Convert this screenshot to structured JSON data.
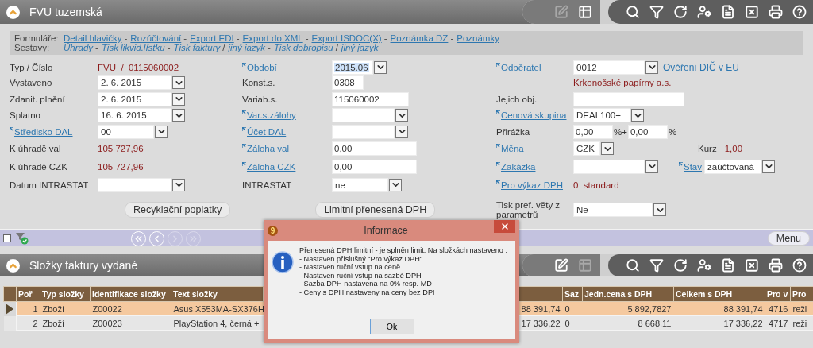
{
  "window": {
    "title": "FVU tuzemská",
    "toolbar": [
      {
        "kind": "edit",
        "disabled": true
      },
      {
        "kind": "table",
        "disabled": false
      },
      {
        "kind": "search",
        "disabled": false
      },
      {
        "kind": "filter",
        "disabled": false
      },
      {
        "kind": "refresh",
        "disabled": false
      },
      {
        "kind": "user-settings",
        "disabled": false
      },
      {
        "kind": "document",
        "disabled": false
      },
      {
        "kind": "excel",
        "disabled": false
      },
      {
        "kind": "print",
        "disabled": false
      },
      {
        "kind": "help",
        "disabled": false
      }
    ]
  },
  "links": [
    {
      "title": "Formuláře:",
      "items": [
        {
          "label": "Detail hlavičky",
          "separator": "-"
        },
        {
          "label": "Rozúčtování",
          "separator": "-"
        },
        {
          "label": "Export EDI",
          "separator": "-"
        },
        {
          "label": "Export do XML",
          "separator": "-"
        },
        {
          "label": "Export ISDOC(X)",
          "separator": "-"
        },
        {
          "label": "Poznámka DZ",
          "separator": "-"
        },
        {
          "label": "Poznámky"
        }
      ]
    },
    {
      "title": "Sestavy:",
      "items": [
        {
          "label": "Úhrady",
          "separator": "-"
        },
        {
          "label": "Tisk likvid.lístku",
          "separator": "-"
        },
        {
          "label": "Tisk faktury",
          "separator": "/"
        },
        {
          "label": "jiný jazyk",
          "separator": "-"
        },
        {
          "label": "Tisk dobropisu",
          "separator": "/"
        },
        {
          "label": "jiný jazyk"
        }
      ]
    }
  ],
  "form": {
    "columns": [
      [
        {
          "label": "Typ / Číslo",
          "linked": false,
          "kind": "value",
          "value": "FVU  /  0115060002"
        },
        {
          "label": "Vystaveno",
          "linked": false,
          "kind": "select",
          "value": "2. 6. 2015"
        },
        {
          "label": "Zdanit. plnění",
          "linked": false,
          "kind": "select",
          "value": "2. 6. 2015"
        },
        {
          "label": "Splatno",
          "linked": false,
          "kind": "select",
          "value": "16. 6. 2015"
        },
        {
          "label": "Středisko DAL",
          "linked": true,
          "kind": "select",
          "value": "00"
        },
        {
          "label": "K úhradě val",
          "linked": false,
          "kind": "value",
          "value": "105 727,96"
        },
        {
          "label": "K úhradě CZK",
          "linked": false,
          "kind": "value",
          "value": "105 727,96"
        },
        {
          "label": "Datum INTRASTAT",
          "linked": false,
          "kind": "select"
        }
      ],
      [
        {
          "label": "Období",
          "linked": true,
          "kind": "select",
          "value": "2015.06",
          "highlighted": true
        },
        {
          "label": "Konst.s.",
          "linked": false,
          "kind": "input",
          "value": "0308"
        },
        {
          "label": "Variab.s.",
          "linked": false,
          "kind": "input",
          "value": "115060002"
        },
        {
          "label": "Var.s.zálohy",
          "linked": true,
          "kind": "select"
        },
        {
          "label": "Účet DAL",
          "linked": true,
          "kind": "select"
        },
        {
          "label": "Záloha val",
          "linked": true,
          "kind": "input",
          "value": "0,00"
        },
        {
          "label": "Záloha CZK",
          "linked": true,
          "kind": "input",
          "value": "0,00"
        },
        {
          "label": "INTRASTAT",
          "linked": false,
          "kind": "select",
          "value": "ne"
        }
      ],
      [
        {
          "label": "Odběratel",
          "linked": true,
          "kind": "select",
          "value": "0012",
          "link": "Ověření DIČ v EU"
        },
        {
          "kind": "value",
          "value": "Krkonošské papírny a.s."
        },
        {
          "label": "Jejich obj.",
          "linked": false,
          "kind": "input"
        },
        {
          "label": "Cenová skupina",
          "linked": true,
          "kind": "select",
          "value": "DEAL100+"
        },
        {
          "label": "Přirážka",
          "linked": false,
          "kind": "percent",
          "values": [
            "0,00",
            "0,00"
          ],
          "signs": [
            "%+",
            "%"
          ]
        },
        {
          "label": "Měna",
          "linked": true,
          "kind": "select",
          "value": "CZK",
          "extra": {
            "label": "Kurz",
            "linked": false,
            "kind": "value",
            "value": "1,00"
          }
        },
        {
          "label": "Zakázka",
          "linked": true,
          "kind": "select",
          "extra": {
            "label": "Stav",
            "linked": true,
            "kind": "select",
            "value": "zaúčtovaná"
          }
        },
        {
          "label": "Pro výkaz DPH",
          "linked": true,
          "kind": "value",
          "value": "0  standard"
        },
        {
          "label": "Tisk pref. věty z parametrů",
          "linked": false,
          "kind": "select",
          "value": "Ne"
        }
      ]
    ],
    "buttons": [
      "Recyklační poplatky",
      "Limitní přenesená DPH"
    ]
  },
  "navigator": {
    "checked": false,
    "buttons": [
      {
        "kind": "first",
        "disabled": false
      },
      {
        "kind": "prev",
        "disabled": false
      },
      {
        "kind": "next",
        "disabled": true
      },
      {
        "kind": "last",
        "disabled": true
      }
    ],
    "menu": "Menu"
  },
  "subgrid": {
    "title": "Složky faktury vydané",
    "toolbar": [
      {
        "kind": "edit",
        "disabled": false
      },
      {
        "kind": "table",
        "disabled": true
      },
      {
        "kind": "search",
        "disabled": false
      },
      {
        "kind": "filter",
        "disabled": false
      },
      {
        "kind": "refresh",
        "disabled": false
      },
      {
        "kind": "user-settings",
        "disabled": false
      },
      {
        "kind": "document",
        "disabled": false
      },
      {
        "kind": "excel",
        "disabled": false
      },
      {
        "kind": "print",
        "disabled": false
      },
      {
        "kind": "help",
        "disabled": false
      }
    ]
  },
  "table": {
    "columns": [
      {
        "label": "Poř"
      },
      {
        "label": "Typ složky"
      },
      {
        "label": "Identifikace složky"
      },
      {
        "label": "Text složky"
      },
      {},
      {
        "label": "Saz"
      },
      {
        "label": "Jedn.cena s DPH"
      },
      {
        "label": "Celkem s DPH"
      },
      {
        "label": "Pro v"
      },
      {
        "label": "Pro"
      }
    ],
    "rows": [
      {
        "selected": true,
        "cells": [
          "1",
          "Zboží",
          "Z00022",
          "Asus X553MA-SX376H",
          "88 391,74",
          "0",
          "5 892,7827",
          "88 391,74",
          "4716",
          "reži"
        ]
      },
      {
        "selected": false,
        "cells": [
          "2",
          "Zboží",
          "Z00023",
          "PlayStation 4, černá +",
          "17 336,22",
          "0",
          "8 668,11",
          "17 336,22",
          "4717",
          "reži"
        ]
      }
    ]
  },
  "dialog": {
    "badge": "9",
    "title": "Informace",
    "message": "Přenesená DPH limitní - je splněn limit. Na složkách nastaveno :",
    "lines": [
      "- Nastaven příslušný \"Pro výkaz DPH\"",
      "- Nastaven ruční vstup na ceně",
      "- Nastaven ruční vstup na sazbě DPH",
      "- Sazba DPH nastavena na 0% resp. MD",
      "- Ceny s DPH nastaveny na ceny bez DPH"
    ],
    "button": "Ok"
  }
}
